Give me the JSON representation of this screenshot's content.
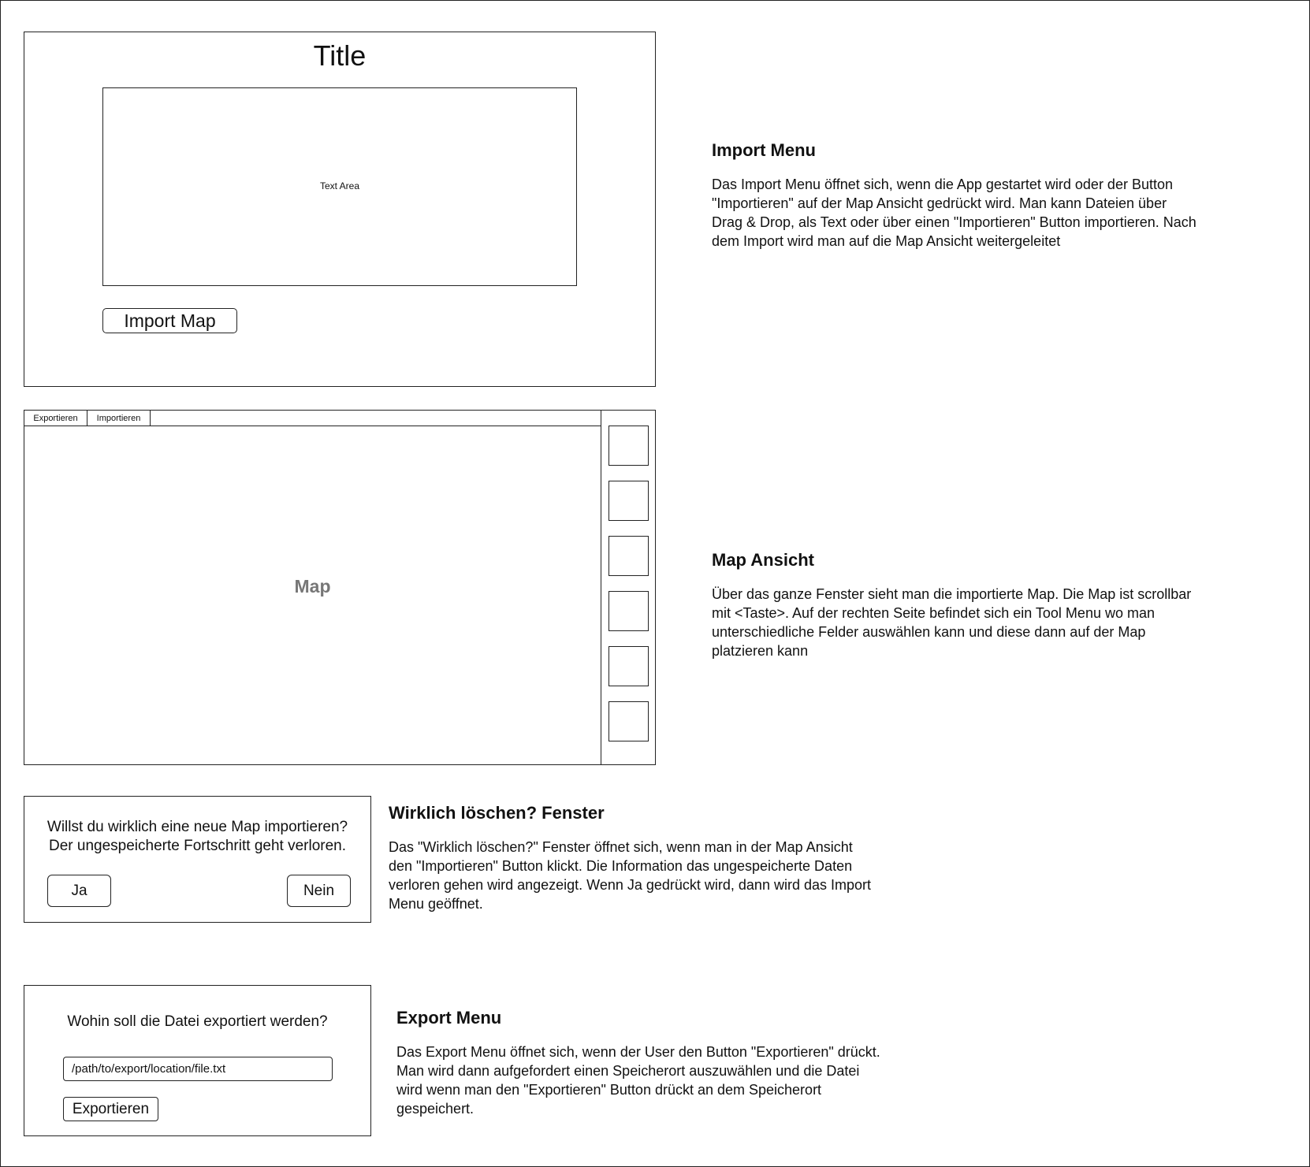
{
  "import_menu": {
    "title": "Title",
    "text_area_label": "Text Area",
    "import_button": "Import Map",
    "description_title": "Import Menu",
    "description_lines": [
      "Das Import Menu öffnet sich, wenn die App gestartet wird oder der Button",
      "\"Importieren\" auf der Map Ansicht gedrückt wird. Man kann Dateien über",
      "Drag & Drop, als Text oder über einen \"Importieren\" Button importieren. Nach",
      "dem Import wird man auf die Map Ansicht weitergeleitet"
    ]
  },
  "map_view": {
    "tabs": [
      "Exportieren",
      "Importieren"
    ],
    "map_label": "Map",
    "tool_count": 6,
    "description_title": "Map Ansicht",
    "description_lines": [
      "Über das ganze Fenster sieht man die importierte Map. Die Map ist scrollbar",
      "mit <Taste>. Auf der rechten Seite befindet sich ein Tool Menu wo man",
      "unterschiedliche Felder auswählen kann und diese dann auf der Map",
      "platzieren kann"
    ]
  },
  "confirm_dialog": {
    "question_line1": "Willst du wirklich eine neue Map importieren?",
    "question_line2": "Der ungespeicherte Fortschritt geht verloren.",
    "yes_button": "Ja",
    "no_button": "Nein",
    "description_title": "Wirklich löschen? Fenster",
    "description_lines": [
      "Das \"Wirklich löschen?\" Fenster öffnet sich, wenn man in der Map Ansicht",
      "den \"Importieren\" Button klickt. Die Information das ungespeicherte Daten",
      "verloren gehen wird angezeigt. Wenn Ja gedrückt wird, dann wird das Import",
      "Menu geöffnet."
    ]
  },
  "export_menu": {
    "question": "Wohin soll die Datei exportiert werden?",
    "path_value": "/path/to/export/location/file.txt",
    "export_button": "Exportieren",
    "description_title": "Export Menu",
    "description_lines": [
      "Das Export Menu öffnet sich, wenn der User den Button \"Exportieren\" drückt.",
      "Man wird dann aufgefordert einen Speicherort auszuwählen und die Datei",
      "wird wenn man den \"Exportieren\" Button drückt an dem Speicherort",
      "gespeichert."
    ]
  }
}
